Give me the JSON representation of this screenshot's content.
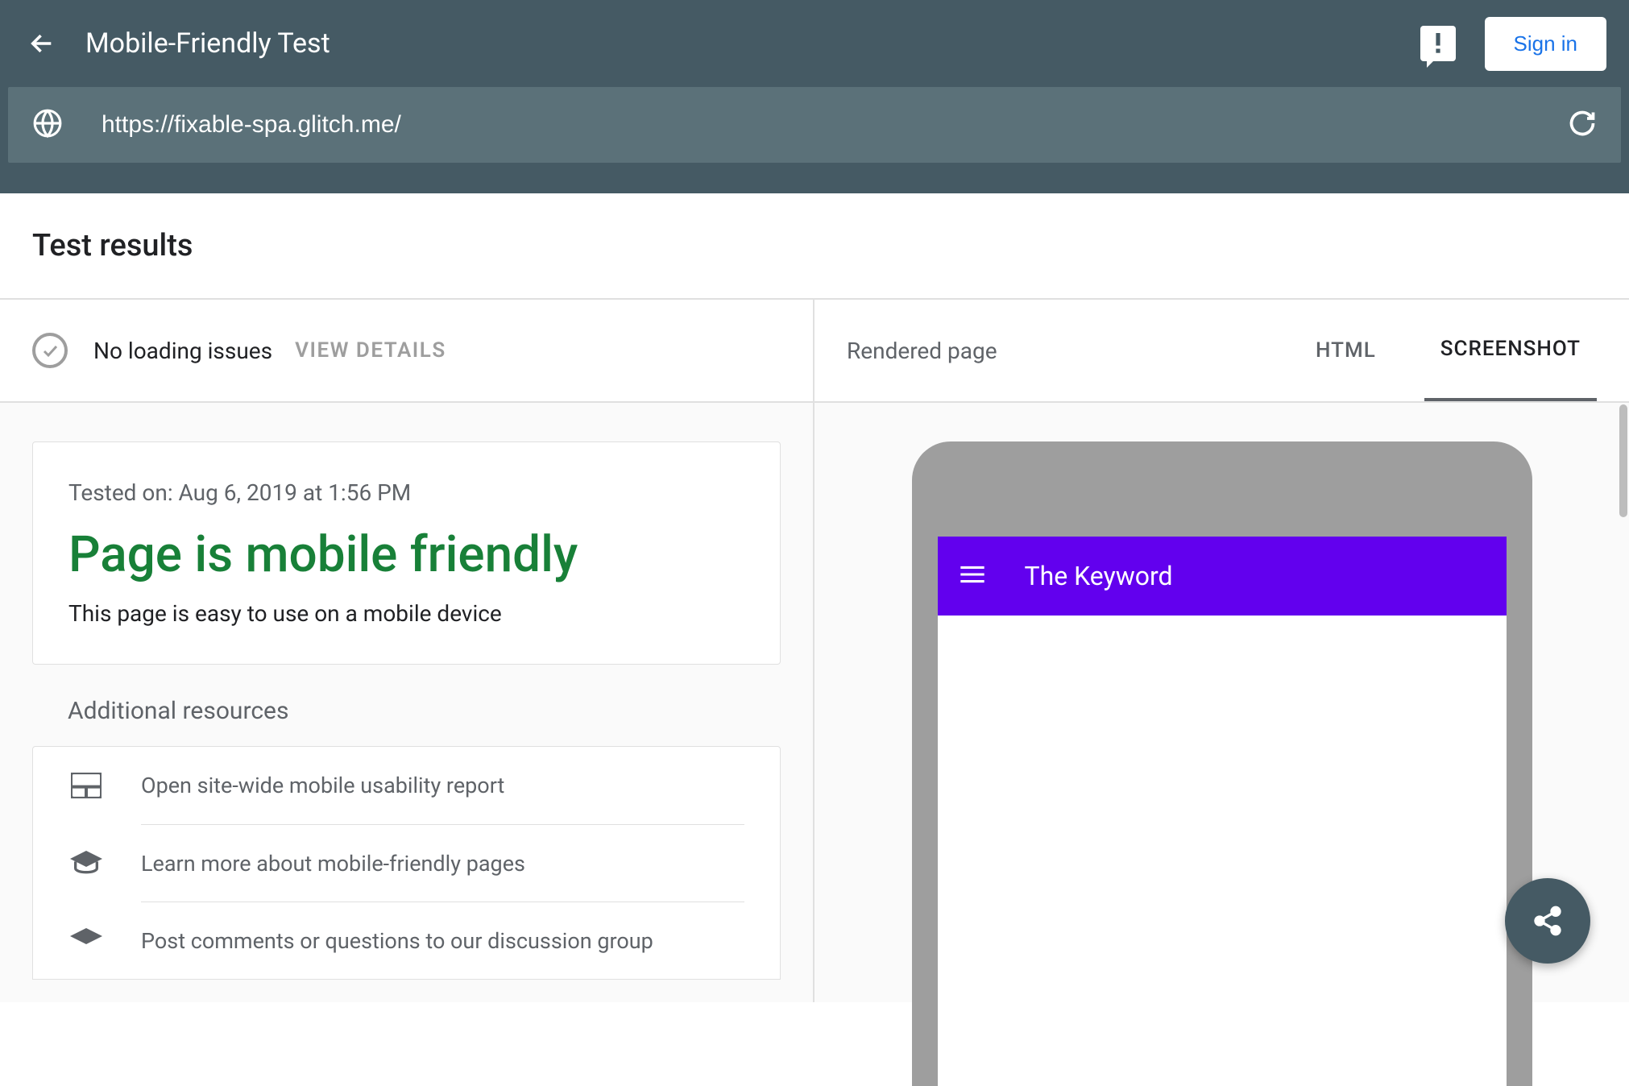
{
  "header": {
    "app_title": "Mobile-Friendly Test",
    "signin_label": "Sign in",
    "url_value": "https://fixable-spa.glitch.me/"
  },
  "section_title": "Test results",
  "left": {
    "loading_status": "No loading issues",
    "view_details_label": "VIEW DETAILS",
    "tested_on": "Tested on: Aug 6, 2019 at 1:56 PM",
    "verdict": "Page is mobile friendly",
    "verdict_sub": "This page is easy to use on a mobile device",
    "resources_heading": "Additional resources",
    "resources": [
      {
        "icon": "browser",
        "label": "Open site-wide mobile usability report"
      },
      {
        "icon": "school",
        "label": "Learn more about mobile-friendly pages"
      },
      {
        "icon": "school",
        "label": "Post comments or questions to our discussion group"
      }
    ]
  },
  "right": {
    "rendered_label": "Rendered page",
    "tabs": {
      "html": "HTML",
      "screenshot": "SCREENSHOT"
    },
    "phone": {
      "app_title": "The Keyword"
    }
  }
}
